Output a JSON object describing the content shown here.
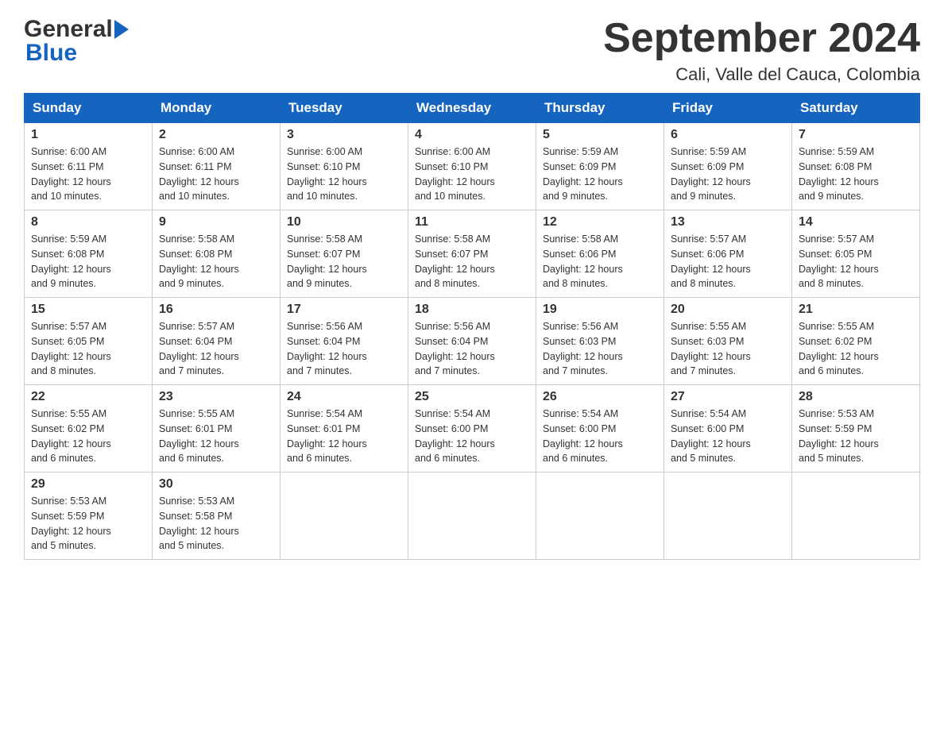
{
  "header": {
    "title": "September 2024",
    "subtitle": "Cali, Valle del Cauca, Colombia",
    "logo_general": "General",
    "logo_blue": "Blue"
  },
  "days_of_week": [
    "Sunday",
    "Monday",
    "Tuesday",
    "Wednesday",
    "Thursday",
    "Friday",
    "Saturday"
  ],
  "weeks": [
    [
      {
        "day": "1",
        "sunrise": "6:00 AM",
        "sunset": "6:11 PM",
        "daylight": "12 hours and 10 minutes."
      },
      {
        "day": "2",
        "sunrise": "6:00 AM",
        "sunset": "6:11 PM",
        "daylight": "12 hours and 10 minutes."
      },
      {
        "day": "3",
        "sunrise": "6:00 AM",
        "sunset": "6:10 PM",
        "daylight": "12 hours and 10 minutes."
      },
      {
        "day": "4",
        "sunrise": "6:00 AM",
        "sunset": "6:10 PM",
        "daylight": "12 hours and 10 minutes."
      },
      {
        "day": "5",
        "sunrise": "5:59 AM",
        "sunset": "6:09 PM",
        "daylight": "12 hours and 9 minutes."
      },
      {
        "day": "6",
        "sunrise": "5:59 AM",
        "sunset": "6:09 PM",
        "daylight": "12 hours and 9 minutes."
      },
      {
        "day": "7",
        "sunrise": "5:59 AM",
        "sunset": "6:08 PM",
        "daylight": "12 hours and 9 minutes."
      }
    ],
    [
      {
        "day": "8",
        "sunrise": "5:59 AM",
        "sunset": "6:08 PM",
        "daylight": "12 hours and 9 minutes."
      },
      {
        "day": "9",
        "sunrise": "5:58 AM",
        "sunset": "6:08 PM",
        "daylight": "12 hours and 9 minutes."
      },
      {
        "day": "10",
        "sunrise": "5:58 AM",
        "sunset": "6:07 PM",
        "daylight": "12 hours and 9 minutes."
      },
      {
        "day": "11",
        "sunrise": "5:58 AM",
        "sunset": "6:07 PM",
        "daylight": "12 hours and 8 minutes."
      },
      {
        "day": "12",
        "sunrise": "5:58 AM",
        "sunset": "6:06 PM",
        "daylight": "12 hours and 8 minutes."
      },
      {
        "day": "13",
        "sunrise": "5:57 AM",
        "sunset": "6:06 PM",
        "daylight": "12 hours and 8 minutes."
      },
      {
        "day": "14",
        "sunrise": "5:57 AM",
        "sunset": "6:05 PM",
        "daylight": "12 hours and 8 minutes."
      }
    ],
    [
      {
        "day": "15",
        "sunrise": "5:57 AM",
        "sunset": "6:05 PM",
        "daylight": "12 hours and 8 minutes."
      },
      {
        "day": "16",
        "sunrise": "5:57 AM",
        "sunset": "6:04 PM",
        "daylight": "12 hours and 7 minutes."
      },
      {
        "day": "17",
        "sunrise": "5:56 AM",
        "sunset": "6:04 PM",
        "daylight": "12 hours and 7 minutes."
      },
      {
        "day": "18",
        "sunrise": "5:56 AM",
        "sunset": "6:04 PM",
        "daylight": "12 hours and 7 minutes."
      },
      {
        "day": "19",
        "sunrise": "5:56 AM",
        "sunset": "6:03 PM",
        "daylight": "12 hours and 7 minutes."
      },
      {
        "day": "20",
        "sunrise": "5:55 AM",
        "sunset": "6:03 PM",
        "daylight": "12 hours and 7 minutes."
      },
      {
        "day": "21",
        "sunrise": "5:55 AM",
        "sunset": "6:02 PM",
        "daylight": "12 hours and 6 minutes."
      }
    ],
    [
      {
        "day": "22",
        "sunrise": "5:55 AM",
        "sunset": "6:02 PM",
        "daylight": "12 hours and 6 minutes."
      },
      {
        "day": "23",
        "sunrise": "5:55 AM",
        "sunset": "6:01 PM",
        "daylight": "12 hours and 6 minutes."
      },
      {
        "day": "24",
        "sunrise": "5:54 AM",
        "sunset": "6:01 PM",
        "daylight": "12 hours and 6 minutes."
      },
      {
        "day": "25",
        "sunrise": "5:54 AM",
        "sunset": "6:00 PM",
        "daylight": "12 hours and 6 minutes."
      },
      {
        "day": "26",
        "sunrise": "5:54 AM",
        "sunset": "6:00 PM",
        "daylight": "12 hours and 6 minutes."
      },
      {
        "day": "27",
        "sunrise": "5:54 AM",
        "sunset": "6:00 PM",
        "daylight": "12 hours and 5 minutes."
      },
      {
        "day": "28",
        "sunrise": "5:53 AM",
        "sunset": "5:59 PM",
        "daylight": "12 hours and 5 minutes."
      }
    ],
    [
      {
        "day": "29",
        "sunrise": "5:53 AM",
        "sunset": "5:59 PM",
        "daylight": "12 hours and 5 minutes."
      },
      {
        "day": "30",
        "sunrise": "5:53 AM",
        "sunset": "5:58 PM",
        "daylight": "12 hours and 5 minutes."
      },
      null,
      null,
      null,
      null,
      null
    ]
  ],
  "labels": {
    "sunrise": "Sunrise:",
    "sunset": "Sunset:",
    "daylight": "Daylight:"
  },
  "colors": {
    "header_bg": "#1565c0",
    "header_text": "#ffffff",
    "border": "#cccccc"
  }
}
